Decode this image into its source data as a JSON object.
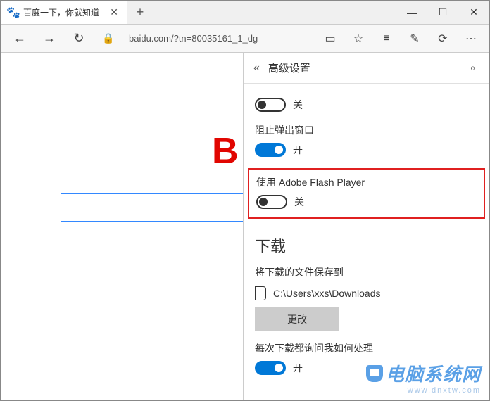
{
  "tab": {
    "title": "百度一下，你就知道"
  },
  "url": "baidu.com/?tn=80035161_1_dg",
  "logo_fragment": "B",
  "panel": {
    "title": "高级设置",
    "setting1": {
      "state": "off",
      "label": "关"
    },
    "popups": {
      "title": "阻止弹出窗口",
      "state": "on",
      "label": "开"
    },
    "flash": {
      "title": "使用 Adobe Flash Player",
      "state": "off",
      "label": "关"
    },
    "downloads": {
      "section": "下载",
      "save_to": "将下载的文件保存到",
      "path": "C:\\Users\\xxs\\Downloads",
      "change": "更改",
      "ask": "每次下载都询问我如何处理",
      "ask_state": "on",
      "ask_label": "开"
    }
  },
  "watermark": {
    "main": "电脑系统网",
    "sub": "www.dnxtw.com"
  }
}
